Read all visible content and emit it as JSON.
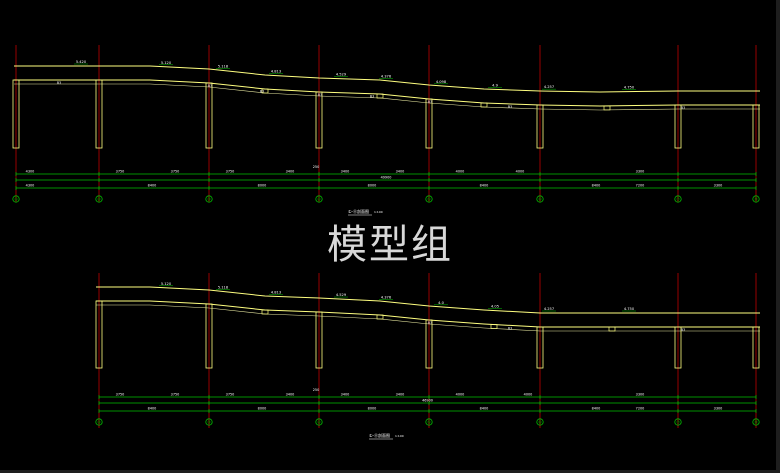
{
  "watermark": "模型组",
  "colors": {
    "background": "#000000",
    "axis_line": "#c00000",
    "structure": "#ffff80",
    "structure_light": "#e8e8a0",
    "dimension": "#00c000",
    "text": "#ffffff"
  },
  "section_a": {
    "title": "①-⑪剖面图",
    "scale": "1:100",
    "axis_labels": [
      "①",
      "②",
      "③",
      "④",
      "⑤",
      "⑥",
      "⑦",
      "⑪"
    ],
    "elevations": [
      "5.420",
      "5.120",
      "5.118",
      "4.813",
      "4.529",
      "4.376",
      "4.098",
      "4.9",
      "4.257",
      "4.750"
    ],
    "room_tags": [
      "B3",
      "B3",
      "B3",
      "B3",
      "B3",
      "B3",
      "B3",
      "B3"
    ],
    "dim_row1": [
      "4300",
      "3750",
      "3750",
      "3750",
      "3400",
      "3400",
      "3400",
      "4000",
      "4000",
      "3300"
    ],
    "dim_row2": [
      "4300",
      "8400",
      "8000",
      "8000",
      "8400",
      "8400",
      "7200",
      "3300"
    ],
    "total": "49900",
    "mid_mark": "250"
  },
  "section_b": {
    "title": "①-⑪剖面图",
    "scale": "1:100",
    "axis_labels": [
      "②",
      "③",
      "④",
      "⑤",
      "⑥",
      "⑦",
      "⑪"
    ],
    "elevations": [
      "5.120",
      "5.118",
      "4.813",
      "4.529",
      "4.376",
      "4.0",
      "4.05",
      "4.257",
      "4.750"
    ],
    "room_tags": [
      "B3",
      "B3",
      "B3"
    ],
    "dim_row1": [
      "3750",
      "3750",
      "3750",
      "3400",
      "3400",
      "3400",
      "4000",
      "4000",
      "3300"
    ],
    "dim_row2": [
      "8400",
      "8000",
      "8000",
      "8400",
      "8400",
      "7200",
      "3300"
    ],
    "total": "46900",
    "mid_mark": "250"
  }
}
